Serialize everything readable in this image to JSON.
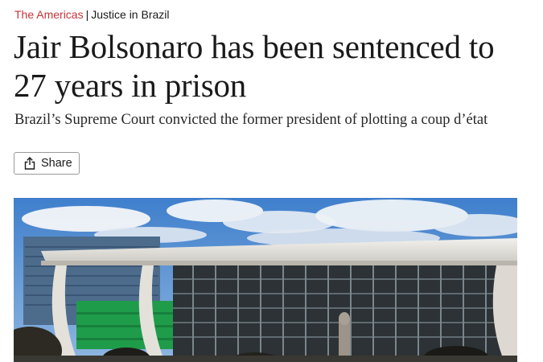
{
  "breadcrumb": {
    "section": "The Americas",
    "separator": "|",
    "subsection": "Justice in Brazil"
  },
  "article": {
    "headline": "Jair Bolsonaro has been sentenced to 27 years in prison",
    "standfirst": "Brazil’s Supreme Court convicted the former president of plotting a coup d’état"
  },
  "share": {
    "label": "Share",
    "icon": "share-icon"
  },
  "image": {
    "subject": "supreme-court-building-photo"
  },
  "colors": {
    "section_accent": "#c4343a",
    "text": "#1a1a1a",
    "button_border": "#9a9a9a"
  }
}
